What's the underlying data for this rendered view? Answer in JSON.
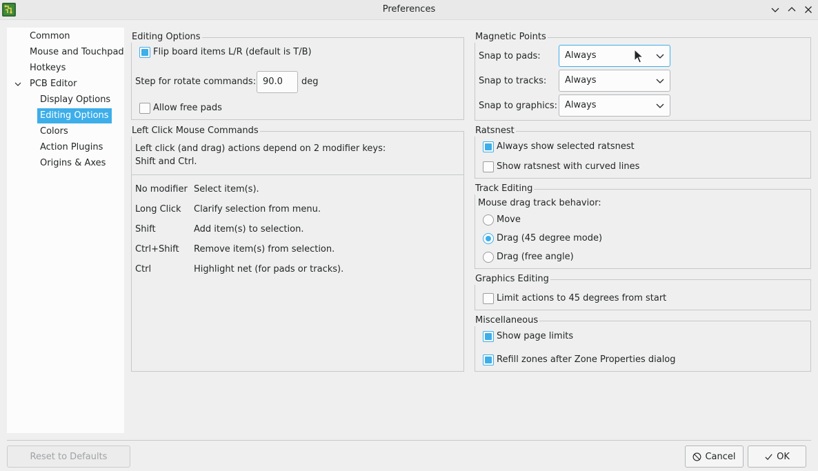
{
  "window": {
    "title": "Preferences"
  },
  "sidebar": {
    "items": [
      {
        "label": "Common"
      },
      {
        "label": "Mouse and Touchpad"
      },
      {
        "label": "Hotkeys"
      },
      {
        "label": "PCB Editor"
      },
      {
        "label": "Display Options"
      },
      {
        "label": "Editing Options"
      },
      {
        "label": "Colors"
      },
      {
        "label": "Action Plugins"
      },
      {
        "label": "Origins & Axes"
      }
    ]
  },
  "editing_options": {
    "title": "Editing Options",
    "flip_label": "Flip board items L/R (default is T/B)",
    "rotate_label": "Step for rotate commands:",
    "rotate_value": "90.0",
    "rotate_unit": "deg",
    "free_pads_label": "Allow free pads"
  },
  "left_click": {
    "title": "Left Click Mouse Commands",
    "description_line1": "Left click (and drag) actions depend on 2 modifier keys:",
    "description_line2": "Shift and Ctrl.",
    "commands": [
      {
        "key": "No modifier",
        "desc": "Select item(s)."
      },
      {
        "key": "Long Click",
        "desc": "Clarify selection from menu."
      },
      {
        "key": "Shift",
        "desc": "Add item(s) to selection."
      },
      {
        "key": "Ctrl+Shift",
        "desc": "Remove item(s) from selection."
      },
      {
        "key": "Ctrl",
        "desc": "Highlight net (for pads or tracks)."
      }
    ]
  },
  "magnetic": {
    "title": "Magnetic Points",
    "pads_label": "Snap to pads:",
    "pads_value": "Always",
    "tracks_label": "Snap to tracks:",
    "tracks_value": "Always",
    "graphics_label": "Snap to graphics:",
    "graphics_value": "Always"
  },
  "ratsnest": {
    "title": "Ratsnest",
    "show_selected_label": "Always show selected ratsnest",
    "curved_label": "Show ratsnest with curved lines"
  },
  "track_editing": {
    "title": "Track Editing",
    "drag_label": "Mouse drag track behavior:",
    "move_label": "Move",
    "drag45_label": "Drag (45 degree mode)",
    "dragfree_label": "Drag (free angle)"
  },
  "graphics_editing": {
    "title": "Graphics Editing",
    "limit_label": "Limit actions to 45 degrees from start"
  },
  "misc": {
    "title": "Miscellaneous",
    "page_limits_label": "Show page limits",
    "refill_label": "Refill zones after Zone Properties dialog"
  },
  "footer": {
    "reset_label": "Reset to Defaults",
    "cancel_label": "Cancel",
    "ok_label": "OK"
  },
  "colors": {
    "accent": "#3daee9",
    "background": "#efefef"
  }
}
